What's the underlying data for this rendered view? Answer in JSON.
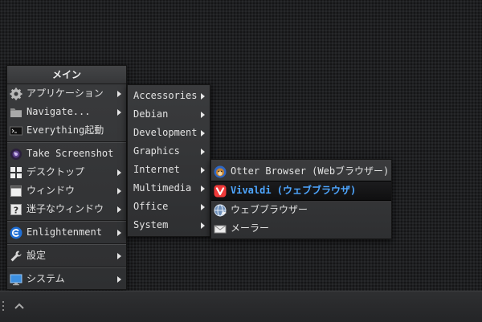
{
  "main_menu": {
    "title": "メイン",
    "items": [
      {
        "label": "アプリケーション",
        "icon": "gear-icon",
        "submenu": true
      },
      {
        "label": "Navigate...",
        "icon": "folder-icon",
        "submenu": true
      },
      {
        "label": "Everything起動",
        "icon": "terminal-icon",
        "submenu": false
      },
      {
        "label": "Take Screenshot",
        "icon": "camera-icon",
        "submenu": false
      },
      {
        "label": "デスクトップ",
        "icon": "desktop-grid-icon",
        "submenu": true
      },
      {
        "label": "ウィンドウ",
        "icon": "window-icon",
        "submenu": true
      },
      {
        "label": "迷子なウィンドウ",
        "icon": "question-window-icon",
        "submenu": true
      },
      {
        "label": "Enlightenment",
        "icon": "enlightenment-logo-icon",
        "submenu": true
      },
      {
        "label": "設定",
        "icon": "wrench-icon",
        "submenu": true
      },
      {
        "label": "システム",
        "icon": "monitor-icon",
        "submenu": true
      }
    ]
  },
  "applications_menu": {
    "items": [
      {
        "label": "Accessories"
      },
      {
        "label": "Debian"
      },
      {
        "label": "Development"
      },
      {
        "label": "Graphics"
      },
      {
        "label": "Internet"
      },
      {
        "label": "Multimedia"
      },
      {
        "label": "Office"
      },
      {
        "label": "System"
      }
    ]
  },
  "internet_menu": {
    "items": [
      {
        "label": "Otter Browser (Webブラウザー)",
        "icon": "otter-browser-icon"
      },
      {
        "label": "Vivaldi (ウェブブラウザ)",
        "icon": "vivaldi-icon",
        "selected": true
      },
      {
        "label": "ウェブブラウザー",
        "icon": "web-browser-globe-icon"
      },
      {
        "label": "メーラー",
        "icon": "mail-envelope-icon"
      }
    ]
  },
  "colors": {
    "selected_text": "#4ea6ff",
    "menu_bg": "#353638",
    "desktop_bg": "#1e1f21"
  }
}
